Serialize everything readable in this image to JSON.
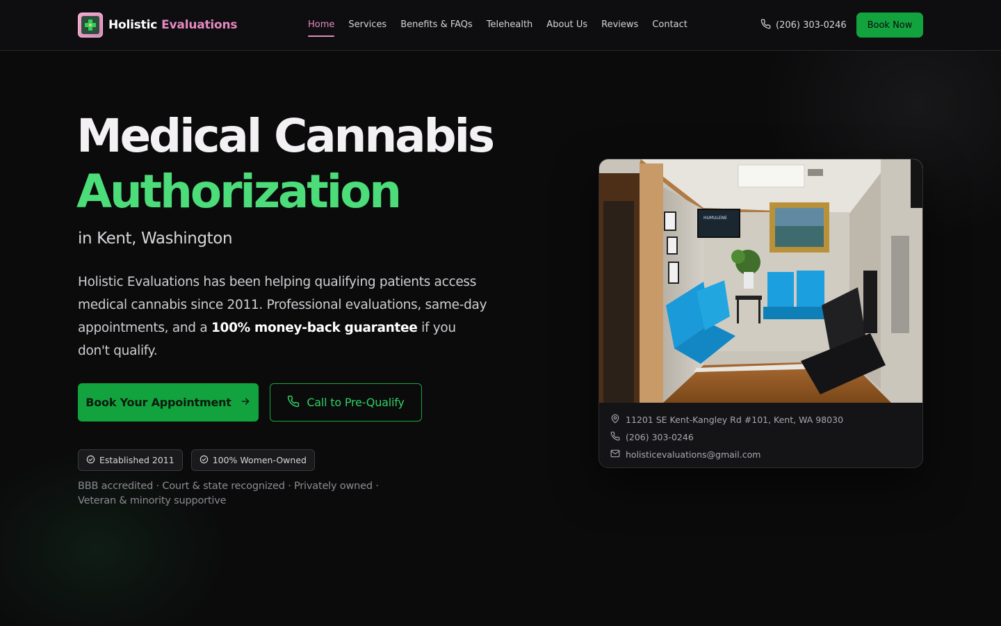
{
  "brand": {
    "name_part1": "Holistic",
    "name_part2": "Evaluations",
    "accent_pink": "#e68ac0",
    "accent_green": "#12a33e"
  },
  "nav": {
    "items": [
      {
        "label": "Home",
        "active": true
      },
      {
        "label": "Services",
        "active": false
      },
      {
        "label": "Benefits & FAQs",
        "active": false
      },
      {
        "label": "Telehealth",
        "active": false
      },
      {
        "label": "About Us",
        "active": false
      },
      {
        "label": "Reviews",
        "active": false
      },
      {
        "label": "Contact",
        "active": false
      }
    ]
  },
  "header": {
    "phone": "(206) 303-0246",
    "book_label": "Book Now",
    "phone_icon": "phone-icon"
  },
  "hero": {
    "title_line1": "Medical Cannabis",
    "title_line2": "Authorization",
    "subtitle": "in Kent, Washington",
    "desc_before": "Holistic Evaluations has been helping qualifying patients access medical cannabis since 2011. Professional evaluations, same-day appointments, and a ",
    "desc_bold": "100% money-back guarantee",
    "desc_after": " if you don't qualify.",
    "primary_cta": "Book Your Appointment",
    "secondary_cta": "Call to Pre-Qualify",
    "badges": [
      "Established 2011",
      "100% Women-Owned"
    ],
    "trust_line": "BBB accredited · Court & state recognized · Privately owned · Veteran & minority supportive"
  },
  "card": {
    "address": "11201 SE Kent-Kangley Rd #101, Kent, WA 98030",
    "phone": "(206) 303-0246",
    "email": "holisticevaluations@gmail.com",
    "tv_text": "HUMULENE"
  }
}
